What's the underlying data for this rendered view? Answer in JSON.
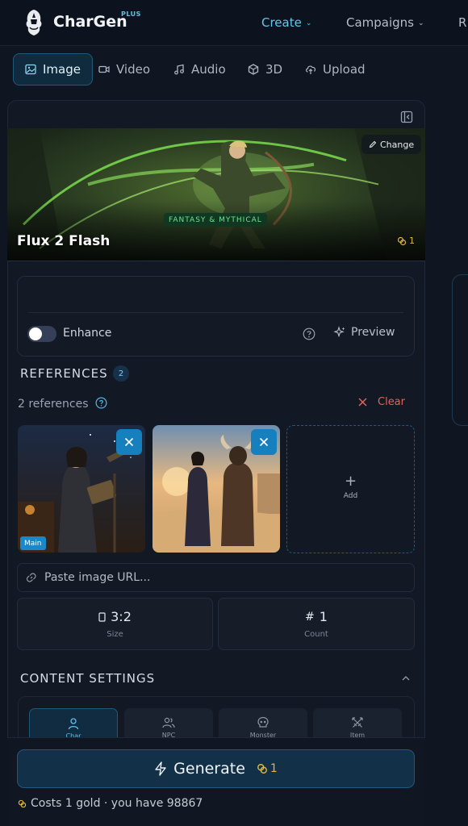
{
  "brand": {
    "name": "CharGen",
    "badge": "PLUS"
  },
  "nav": {
    "items": [
      {
        "label": "Create",
        "active": true
      },
      {
        "label": "Campaigns",
        "active": false
      },
      {
        "label": "R",
        "active": false
      }
    ]
  },
  "media_tabs": [
    {
      "label": "Image",
      "icon": "image-icon",
      "active": true
    },
    {
      "label": "Video",
      "icon": "video-icon",
      "active": false
    },
    {
      "label": "Audio",
      "icon": "music-icon",
      "active": false
    },
    {
      "label": "3D",
      "icon": "cube-icon",
      "active": false
    },
    {
      "label": "Upload",
      "icon": "upload-icon",
      "active": false
    }
  ],
  "model": {
    "name": "Flux 2 Flash",
    "category": "FANTASY & MYTHICAL",
    "change_label": "Change",
    "cost": "1"
  },
  "prompt": {
    "value": "",
    "enhance_label": "Enhance",
    "enhance_on": false,
    "preview_label": "Preview"
  },
  "references": {
    "title": "REFERENCES",
    "count": "2",
    "summary": "2 references",
    "clear_label": "Clear",
    "main_badge": "Main",
    "add_label": "Add",
    "url_placeholder": "Paste image URL..."
  },
  "options": {
    "size": {
      "value": "3:2",
      "label": "Size"
    },
    "count": {
      "value": "1",
      "label": "Count"
    }
  },
  "content_settings": {
    "title": "CONTENT SETTINGS",
    "tabs": [
      {
        "label": "Char",
        "icon": "user-icon",
        "active": true
      },
      {
        "label": "NPC",
        "icon": "users-icon",
        "active": false
      },
      {
        "label": "Monster",
        "icon": "skull-icon",
        "active": false
      },
      {
        "label": "Item",
        "icon": "swords-icon",
        "active": false
      }
    ]
  },
  "generate": {
    "label": "Generate",
    "cost": "1",
    "cost_line": "Costs 1 gold · you have 98867"
  },
  "colors": {
    "accent": "#63c6ea",
    "gold": "#e2b83b",
    "danger": "#e0645a",
    "background": "#0f1521"
  }
}
